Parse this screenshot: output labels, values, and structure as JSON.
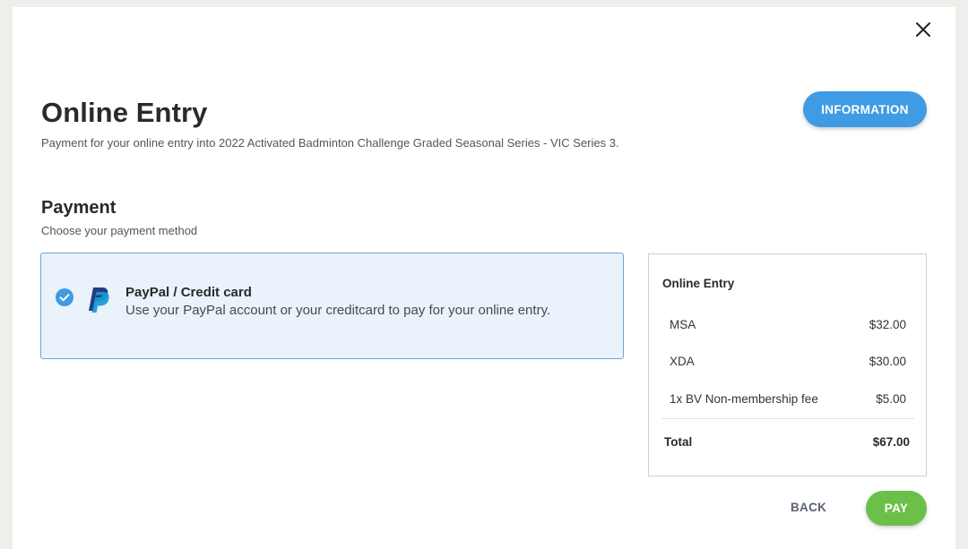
{
  "modal": {
    "title": "Online Entry",
    "subtitle": "Payment for your online entry into 2022 Activated Badminton Challenge Graded Seasonal Series - VIC Series 3.",
    "information_label": "INFORMATION"
  },
  "payment": {
    "title": "Payment",
    "subtitle": "Choose your payment method",
    "methods": [
      {
        "title": "PayPal / Credit card",
        "description": "Use your PayPal account or your creditcard to pay for your online entry.",
        "selected": true,
        "icon": "paypal-icon"
      }
    ]
  },
  "summary": {
    "title": "Online Entry",
    "items": [
      {
        "label": "MSA",
        "amount": "$32.00"
      },
      {
        "label": "XDA",
        "amount": "$30.00"
      },
      {
        "label": "1x BV Non-membership fee",
        "amount": "$5.00"
      }
    ],
    "total_label": "Total",
    "total_amount": "$67.00"
  },
  "actions": {
    "back_label": "BACK",
    "pay_label": "PAY"
  },
  "colors": {
    "accent": "#3f9be3",
    "pay": "#6cc04a",
    "selected_bg": "#eaf2fb"
  }
}
